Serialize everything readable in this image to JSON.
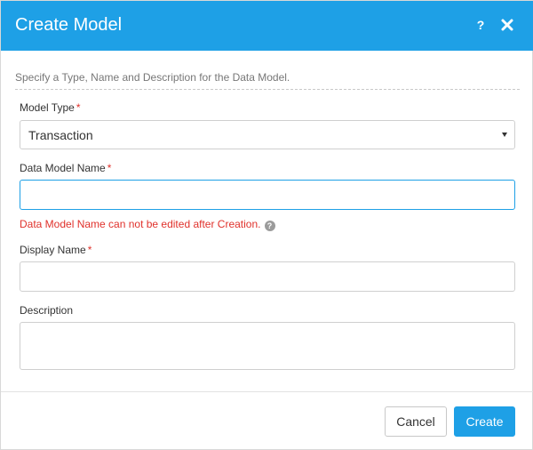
{
  "dialog": {
    "title": "Create Model",
    "help_icon": "question-mark-icon",
    "close_icon": "close-icon"
  },
  "form": {
    "instruction": "Specify a Type, Name and Description for the Data Model.",
    "required_marker": "*",
    "model_type": {
      "label": "Model Type",
      "selected": "Transaction"
    },
    "data_model_name": {
      "label": "Data Model Name",
      "value": "",
      "placeholder": "",
      "error": "Data Model Name can not be edited after Creation."
    },
    "display_name": {
      "label": "Display Name",
      "value": "",
      "placeholder": ""
    },
    "description": {
      "label": "Description",
      "value": "",
      "placeholder": ""
    }
  },
  "footer": {
    "cancel_label": "Cancel",
    "create_label": "Create"
  },
  "colors": {
    "header_bg": "#1ea0e6",
    "required": "#e0312b",
    "error_text": "#e0312b",
    "primary_button": "#1ea0e6"
  }
}
